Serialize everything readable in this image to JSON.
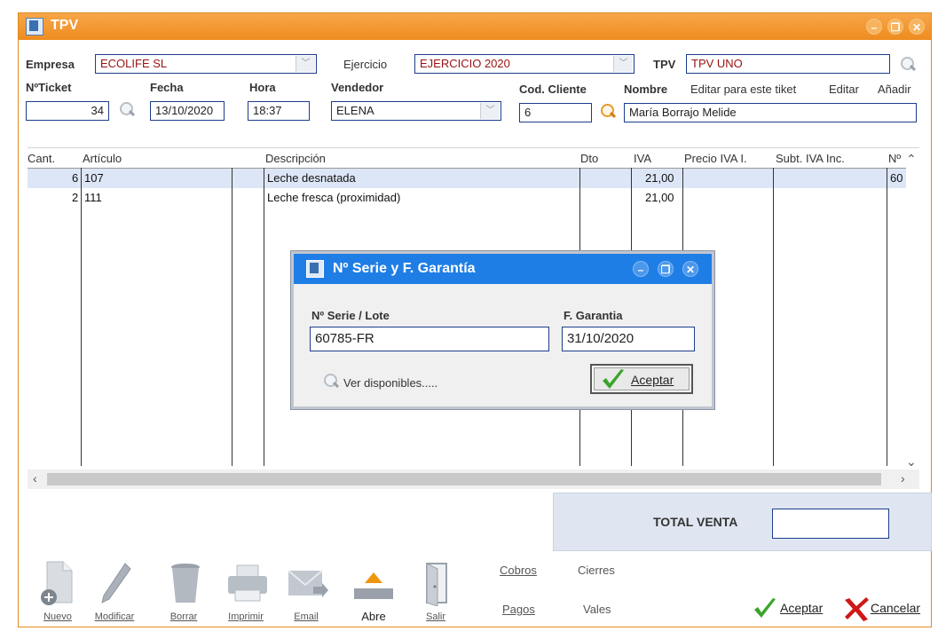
{
  "window": {
    "title": "TPV",
    "buttons": [
      "minimize",
      "restore",
      "close"
    ]
  },
  "header": {
    "empresa_label": "Empresa",
    "empresa_value": "ECOLIFE SL",
    "ejercicio_label": "Ejercicio",
    "ejercicio_value": "EJERCICIO 2020",
    "tpv_label": "TPV",
    "tpv_value": "TPV UNO",
    "ticket_label": "NºTicket",
    "ticket_value": "34",
    "fecha_label": "Fecha",
    "fecha_value": "13/10/2020",
    "hora_label": "Hora",
    "hora_value": "18:37",
    "vendedor_label": "Vendedor",
    "vendedor_value": "ELENA",
    "codcliente_label": "Cod. Cliente",
    "codcliente_value": "6",
    "nombre_label": "Nombre",
    "nombre_value": "María Borrajo Melide",
    "editar_tiket_label": "Editar para este tiket",
    "editar_label": "Editar",
    "anadir_label": "Añadir"
  },
  "grid": {
    "columns": [
      "Cant.",
      "Artículo",
      "Descripción",
      "Dto",
      "IVA",
      "Precio IVA I.",
      "Subt. IVA Inc.",
      "Nº"
    ],
    "rows": [
      {
        "cant": "6",
        "articulo": "107",
        "descripcion": "Leche desnatada",
        "dto": "",
        "iva": "21,00",
        "precio": "",
        "subt": "",
        "n": "60"
      },
      {
        "cant": "2",
        "articulo": "111",
        "descripcion": "Leche fresca (proximidad)",
        "dto": "",
        "iva": "21,00",
        "precio": "",
        "subt": "",
        "n": ""
      }
    ]
  },
  "total": {
    "label": "TOTAL VENTA",
    "value": ""
  },
  "toolbar": {
    "nuevo": "Nuevo",
    "modificar": "Modificar",
    "borrar": "Borrar",
    "imprimir": "Imprimir",
    "email": "Email",
    "abre": "Abre",
    "salir": "Salir",
    "cobros": "Cobros",
    "pagos": "Pagos",
    "cierres": "Cierres",
    "vales": "Vales",
    "aceptar": "Aceptar",
    "cancelar": "Cancelar"
  },
  "dialog": {
    "title": "Nº Serie y F. Garantía",
    "serie_label": "Nº Serie / Lote",
    "serie_value": "60785-FR",
    "garantia_label": "F. Garantia",
    "garantia_value": "31/10/2020",
    "ver_disponibles": "Ver disponibles.....",
    "aceptar": "Aceptar"
  },
  "colors": {
    "title_orange": "#ee8c1f",
    "dialog_blue": "#1f7ee6",
    "field_border": "#1d3c8c",
    "text_red": "#9a1010",
    "check_green": "#3aa42a",
    "cancel_red": "#d01818"
  }
}
